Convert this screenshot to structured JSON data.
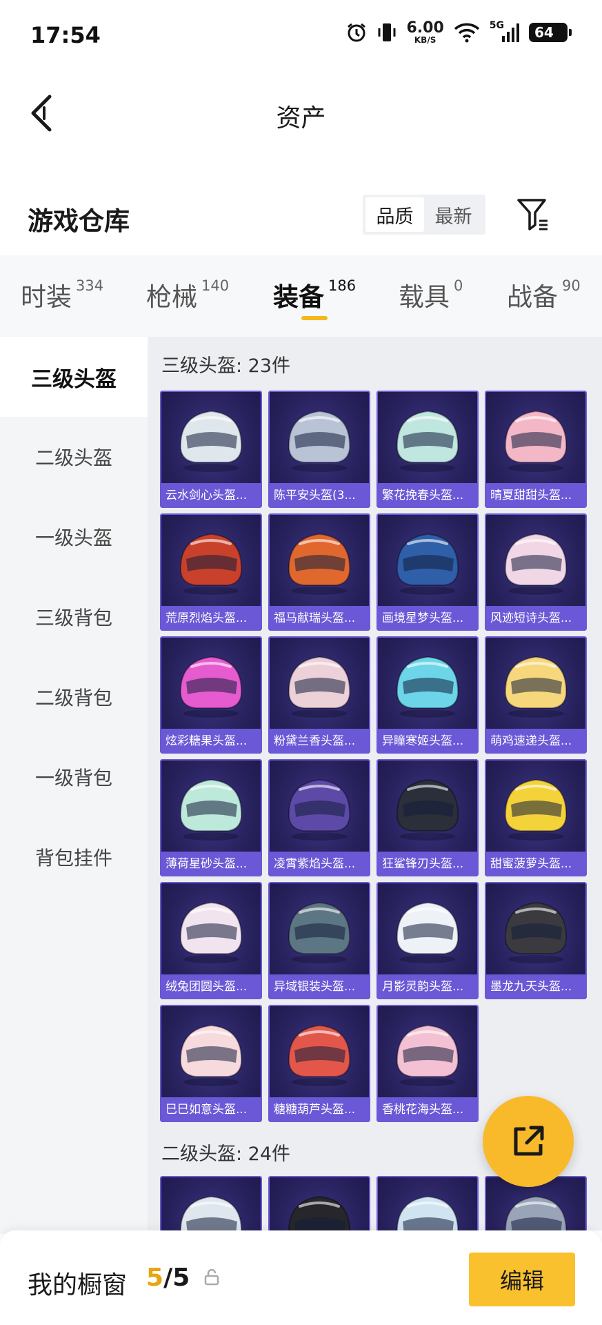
{
  "status_bar": {
    "time": "17:54",
    "net_speed": "6.00",
    "net_unit": "KB/S",
    "signal_label": "5G",
    "battery": "64"
  },
  "header": {
    "title": "资产"
  },
  "warehouse": {
    "title": "游戏仓库",
    "sort_options": [
      "品质",
      "最新"
    ]
  },
  "category_tabs": [
    {
      "label": "时装",
      "count": "334"
    },
    {
      "label": "枪械",
      "count": "140"
    },
    {
      "label": "装备",
      "count": "186"
    },
    {
      "label": "载具",
      "count": "0"
    },
    {
      "label": "战备",
      "count": "90"
    }
  ],
  "sidebar": [
    "三级头盔",
    "二级头盔",
    "一级头盔",
    "三级背包",
    "二级背包",
    "一级背包",
    "背包挂件"
  ],
  "sections": [
    {
      "title": "三级头盔: 23件"
    },
    {
      "title": "二级头盔: 24件"
    }
  ],
  "items": [
    {
      "name": "云水剑心头盔...",
      "color": "#dfe7ec"
    },
    {
      "name": "陈平安头盔(3...",
      "color": "#b9c3d6"
    },
    {
      "name": "繁花挽春头盔...",
      "color": "#bfe6df"
    },
    {
      "name": "晴夏甜甜头盔...",
      "color": "#f4b7c8"
    },
    {
      "name": "荒原烈焰头盔...",
      "color": "#c9412b"
    },
    {
      "name": "福马献瑞头盔...",
      "color": "#e0682f"
    },
    {
      "name": "画境星梦头盔...",
      "color": "#2e5fa8"
    },
    {
      "name": "风迹短诗头盔...",
      "color": "#f1d7e6"
    },
    {
      "name": "炫彩糖果头盔...",
      "color": "#e65bd0"
    },
    {
      "name": "粉黛兰香头盔...",
      "color": "#ecd1d9"
    },
    {
      "name": "异瞳寒姬头盔...",
      "color": "#6cd6e8"
    },
    {
      "name": "萌鸡速递头盔...",
      "color": "#f6d77b"
    },
    {
      "name": "薄荷星砂头盔...",
      "color": "#bde9da"
    },
    {
      "name": "凌霄紫焰头盔...",
      "color": "#5d4aa8"
    },
    {
      "name": "狂鲨锋刃头盔...",
      "color": "#2a2f3a"
    },
    {
      "name": "甜蜜菠萝头盔...",
      "color": "#f4d23a"
    },
    {
      "name": "绒兔团圆头盔...",
      "color": "#f2e4ef"
    },
    {
      "name": "异域银装头盔...",
      "color": "#5d7684"
    },
    {
      "name": "月影灵韵头盔...",
      "color": "#eef2f6"
    },
    {
      "name": "墨龙九天头盔...",
      "color": "#3a3a3f"
    },
    {
      "name": "巳巳如意头盔...",
      "color": "#f6dadd"
    },
    {
      "name": "糖糖葫芦头盔...",
      "color": "#e2574a"
    },
    {
      "name": "香桃花海头盔...",
      "color": "#f3c1d3"
    }
  ],
  "peek_items": [
    {
      "color": "#dfe6ee"
    },
    {
      "color": "#26262b"
    },
    {
      "color": "#cfe3f0"
    },
    {
      "color": "#9aa4b8"
    }
  ],
  "bottom_bar": {
    "label": "我的橱窗",
    "current": "5",
    "total": "/5",
    "edit": "编辑"
  },
  "icons": {
    "back": "chevron-left-icon",
    "filter": "filter-icon",
    "share": "share-external-icon",
    "lock": "lock-icon"
  }
}
